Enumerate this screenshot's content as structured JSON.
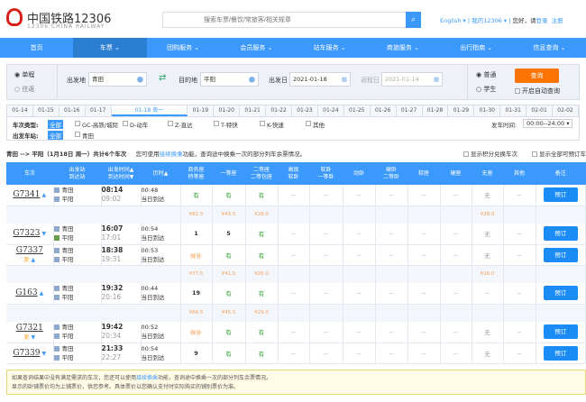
{
  "header": {
    "brand": "中国铁路12306",
    "brand_sub": "12306 CHINA RAILWAY",
    "search_placeholder": "搜索车票/餐饮/常旅客/相关规章",
    "english": "English ▾",
    "my12306": "我的12306 ▾",
    "greeting": "您好，请",
    "login": "登录",
    "register": "注册"
  },
  "nav": [
    "首页",
    "车票 ⌄",
    "团购服务 ⌄",
    "会员服务 ⌄",
    "站车服务 ⌄",
    "商旅服务 ⌄",
    "出行指南 ⌄",
    "信息查询 ⌄"
  ],
  "query": {
    "oneway": "单程",
    "roundtrip": "往返",
    "from_label": "出发地",
    "from": "青田",
    "to_label": "目的地",
    "to": "平阳",
    "date_label": "出发日",
    "date": "2021-01-18",
    "return_label": "返程日",
    "return_date": "2021-01-14",
    "normal": "普通",
    "student": "学生",
    "search": "查询",
    "auto": "开启自动查询"
  },
  "dates": [
    "01-14",
    "01-15",
    "01-16",
    "01-17",
    "01-18 周一",
    "01-19",
    "01-20",
    "01-21",
    "01-22",
    "01-23",
    "01-24",
    "01-25",
    "01-26",
    "01-27",
    "01-28",
    "01-29",
    "01-30",
    "01-31",
    "02-01",
    "02-02"
  ],
  "filters": {
    "type_label": "车次类型:",
    "all": "全部",
    "types": [
      "GC-高铁/城际",
      "D-动车",
      "Z-直达",
      "T-特快",
      "K-快速",
      "其他"
    ],
    "station_label": "出发车站:",
    "station": "青田",
    "time_label": "发车时间:",
    "time": "00:00--24:00 ▾"
  },
  "summary": {
    "route": "青田 --> 平阳（1月18日 周一）共计6个车次",
    "tip_pre": "您可使用",
    "tip_link": "接续换乘",
    "tip_post": "功能，查询途中换乘一次的部分列车余票情况。",
    "opt1": "显示积分兑换车次",
    "opt2": "显示全部可预订车次"
  },
  "columns": [
    "车次",
    "出发站\n到达站",
    "出发时间▲\n到达时间▼",
    "历时▲",
    "商务座\n特等座",
    "一等座",
    "二等座\n二等包座",
    "高级\n软卧",
    "软卧\n一等卧",
    "动卧",
    "硬卧\n二等卧",
    "软座",
    "硬座",
    "无座",
    "其他",
    "备注"
  ],
  "trains": [
    {
      "no": "G7341",
      "arrow": "▲",
      "fu": "",
      "from": "青田",
      "to": "平阳",
      "dep": "08:14",
      "arr": "09:02",
      "dur": "00:48",
      "day": "当日到达",
      "seats": [
        "有",
        "有",
        "有",
        "--",
        "--",
        "--",
        "--",
        "--",
        "--",
        "无",
        "--"
      ],
      "prices": [
        "¥81.5",
        "¥43.5",
        "¥28.0",
        "",
        "",
        "",
        "",
        "",
        "",
        "¥28.0",
        ""
      ]
    },
    {
      "no": "G7323",
      "arrow": "▼",
      "fu": "",
      "from": "青田",
      "to": "平阳",
      "dep": "16:07",
      "arr": "17:01",
      "dur": "00:54",
      "day": "当日到达",
      "seats": [
        "1",
        "5",
        "有",
        "--",
        "--",
        "--",
        "--",
        "--",
        "--",
        "无",
        "--"
      ]
    },
    {
      "no": "G7337",
      "arrow": "▲",
      "fu": "复",
      "from": "青田",
      "to": "平阳",
      "dep": "18:38",
      "arr": "19:31",
      "dur": "00:53",
      "day": "当日到达",
      "seats": [
        "候补",
        "有",
        "有",
        "--",
        "--",
        "--",
        "--",
        "--",
        "--",
        "无",
        "--"
      ],
      "prices": [
        "¥77.5",
        "¥41.5",
        "¥26.0",
        "",
        "",
        "",
        "",
        "",
        "",
        "¥26.0",
        ""
      ]
    },
    {
      "no": "G163",
      "arrow": "▲",
      "fu": "",
      "from": "青田",
      "to": "平阳",
      "dep": "19:32",
      "arr": "20:16",
      "dur": "00:44",
      "day": "当日到达",
      "seats": [
        "19",
        "有",
        "有",
        "--",
        "--",
        "--",
        "--",
        "--",
        "--",
        "--",
        "--"
      ],
      "prices": [
        "¥84.5",
        "¥45.5",
        "¥29.0",
        "",
        "",
        "",
        "",
        "",
        "",
        "",
        ""
      ]
    },
    {
      "no": "G7321",
      "arrow": "▼",
      "fu": "复",
      "from": "青田",
      "to": "平阳",
      "dep": "19:42",
      "arr": "20:34",
      "dur": "00:52",
      "day": "当日到达",
      "seats": [
        "候补",
        "有",
        "有",
        "--",
        "--",
        "--",
        "--",
        "--",
        "--",
        "无",
        "--"
      ]
    },
    {
      "no": "G7339",
      "arrow": "▼",
      "fu": "",
      "from": "青田",
      "to": "平阳",
      "dep": "21:33",
      "arr": "22:27",
      "dur": "00:54",
      "day": "当日到达",
      "seats": [
        "9",
        "有",
        "有",
        "--",
        "--",
        "--",
        "--",
        "--",
        "--",
        "无",
        "--"
      ]
    }
  ],
  "book_label": "预订",
  "notice": {
    "l1_pre": "如果查询结果中没有满足需求的车次，您还可以使用",
    "l1_link": "接续换乘",
    "l1_post": "功能，查询途中换乘一次的部分列车余票情况。",
    "l2": "显示的卧铺票价均为上铺票价，供您参考。具体票价以您确认支付时实际购买的铺别票价为准。"
  }
}
